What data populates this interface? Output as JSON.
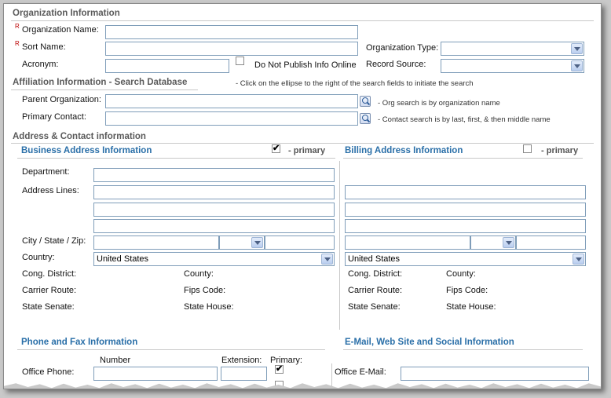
{
  "org_section": {
    "title": "Organization Information",
    "required_marker": "R",
    "org_name_label": "Organization Name:",
    "sort_name_label": "Sort Name:",
    "acronym_label": "Acronym:",
    "do_not_publish_label": "Do Not Publish Info Online",
    "org_type_label": "Organization Type:",
    "record_source_label": "Record Source:",
    "org_type_value": "",
    "record_source_value": ""
  },
  "affiliation": {
    "title": "Affiliation Information - Search Database",
    "hint": "- Click on the ellipse to the right of the search fields to initiate the search",
    "parent_label": "Parent Organization:",
    "parent_note": "- Org search is by organization name",
    "contact_label": "Primary Contact:",
    "contact_note": "- Contact search is by last, first, & then middle name"
  },
  "address": {
    "title": "Address & Contact information",
    "business": {
      "title": "Business Address Information",
      "primary_label": "- primary",
      "primary_checked": true,
      "department_label": "Department:",
      "address_lines_label": "Address Lines:",
      "city_state_zip_label": "City / State / Zip:",
      "country_label": "Country:",
      "country_value": "United States",
      "cong_district_label": "Cong. District:",
      "county_label": "County:",
      "carrier_route_label": "Carrier Route:",
      "fips_code_label": "Fips Code:",
      "state_senate_label": "State Senate:",
      "state_house_label": "State House:"
    },
    "billing": {
      "title": "Billing Address Information",
      "primary_label": "- primary",
      "primary_checked": false,
      "country_value": "United States",
      "cong_district_label": "Cong. District:",
      "county_label": "County:",
      "carrier_route_label": "Carrier Route:",
      "fips_code_label": "Fips Code:",
      "state_senate_label": "State Senate:",
      "state_house_label": "State House:"
    }
  },
  "phone_fax": {
    "title": "Phone and Fax Information",
    "number_header": "Number",
    "extension_header": "Extension:",
    "primary_header": "Primary:",
    "office_phone_label": "Office Phone:",
    "office_phone_primary": true
  },
  "email_web": {
    "title": "E-Mail, Web Site and Social Information",
    "office_email_label": "Office E-Mail:"
  }
}
